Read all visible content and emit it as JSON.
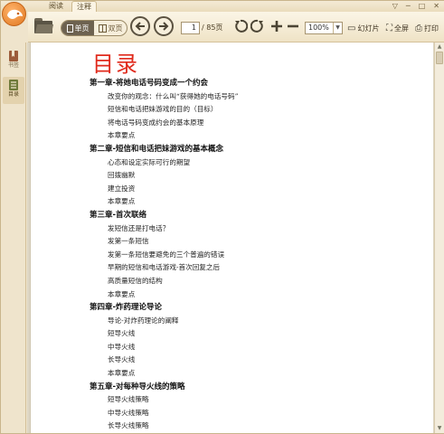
{
  "tabs": [
    {
      "label": "阅读"
    },
    {
      "label": "注释"
    }
  ],
  "window_controls": [
    "▽",
    "─",
    "□",
    "✕"
  ],
  "toolbar": {
    "view_single": "单页",
    "view_double": "双页",
    "page_current": "1",
    "page_total": "/ 85页",
    "zoom": "100%",
    "slideshow": "幻灯片",
    "fullscreen": "全屏",
    "print": "打印"
  },
  "sidebar": {
    "items": [
      {
        "label": "书签"
      },
      {
        "label": "目录"
      }
    ]
  },
  "document": {
    "title": "目录",
    "chapters": [
      {
        "title": "第一章-将她电话号码变成一个约会",
        "items": [
          "改变你的观念：什么叫“获得她的电话号码”",
          "短信和电话把妹游戏的目的（目标）",
          "将电话号码变成约会的基本原理",
          "本章要点"
        ]
      },
      {
        "title": "第二章-短信和电话把妹游戏的基本概念",
        "items": [
          "心态和设定实际可行的期望",
          "回拨幽默",
          "建立投资",
          "本章要点"
        ]
      },
      {
        "title": "第三章-首次联络",
        "items": [
          "发短信还是打电话？",
          "发第一条短信",
          "发第一条短信要避免的三个普遍的错误",
          "早期的短信和电话游戏-首次回复之后",
          "高质量短信的结构",
          "本章要点"
        ]
      },
      {
        "title": "第四章-炸药理论导论",
        "items": [
          "导论-对炸药理论的阐释",
          "短导火线",
          "中导火线",
          "长导火线",
          "本章要点"
        ]
      },
      {
        "title": "第五章-对每种导火线的策略",
        "items": [
          "短导火线策略",
          "中导火线策略",
          "长导火线策略"
        ]
      }
    ]
  },
  "colors": {
    "title_red": "#e02a1c",
    "toolbar_bg": "#f4ead5",
    "logo_orange": "#e0771f"
  }
}
